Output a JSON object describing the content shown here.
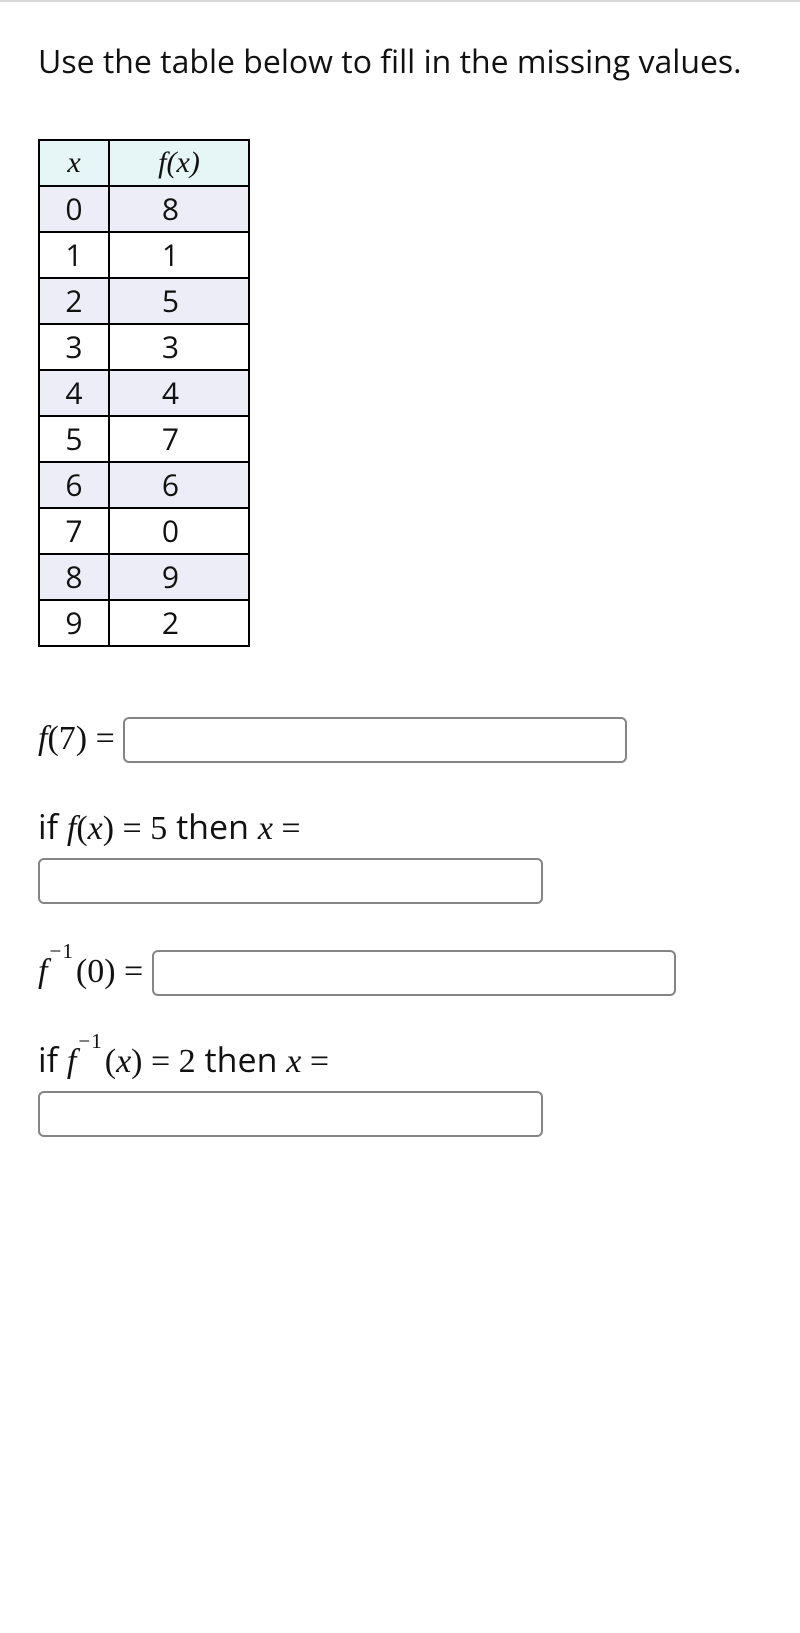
{
  "instructions": "Use the table below to fill in the missing values.",
  "table": {
    "headers": {
      "x": "x",
      "fx": "f(x)"
    },
    "rows": [
      {
        "x": "0",
        "fx": "8"
      },
      {
        "x": "1",
        "fx": "1"
      },
      {
        "x": "2",
        "fx": "5"
      },
      {
        "x": "3",
        "fx": "3"
      },
      {
        "x": "4",
        "fx": "4"
      },
      {
        "x": "5",
        "fx": "7"
      },
      {
        "x": "6",
        "fx": "6"
      },
      {
        "x": "7",
        "fx": "0"
      },
      {
        "x": "8",
        "fx": "9"
      },
      {
        "x": "9",
        "fx": "2"
      }
    ]
  },
  "questions": {
    "q1": {
      "prefix_f": "f",
      "prefix_paren": "(7) ="
    },
    "q2": {
      "pre_if": "if ",
      "f": "f",
      "paren": "(x) = 5",
      "then": " then ",
      "x": "x",
      "eq": " ="
    },
    "q3": {
      "f": "f",
      "sup": "−1",
      "paren": "(0) ="
    },
    "q4": {
      "pre_if": "if ",
      "f": "f",
      "sup": "−1",
      "paren": "(x) = 2",
      "then": " then ",
      "x": "x",
      "eq": " ="
    }
  }
}
